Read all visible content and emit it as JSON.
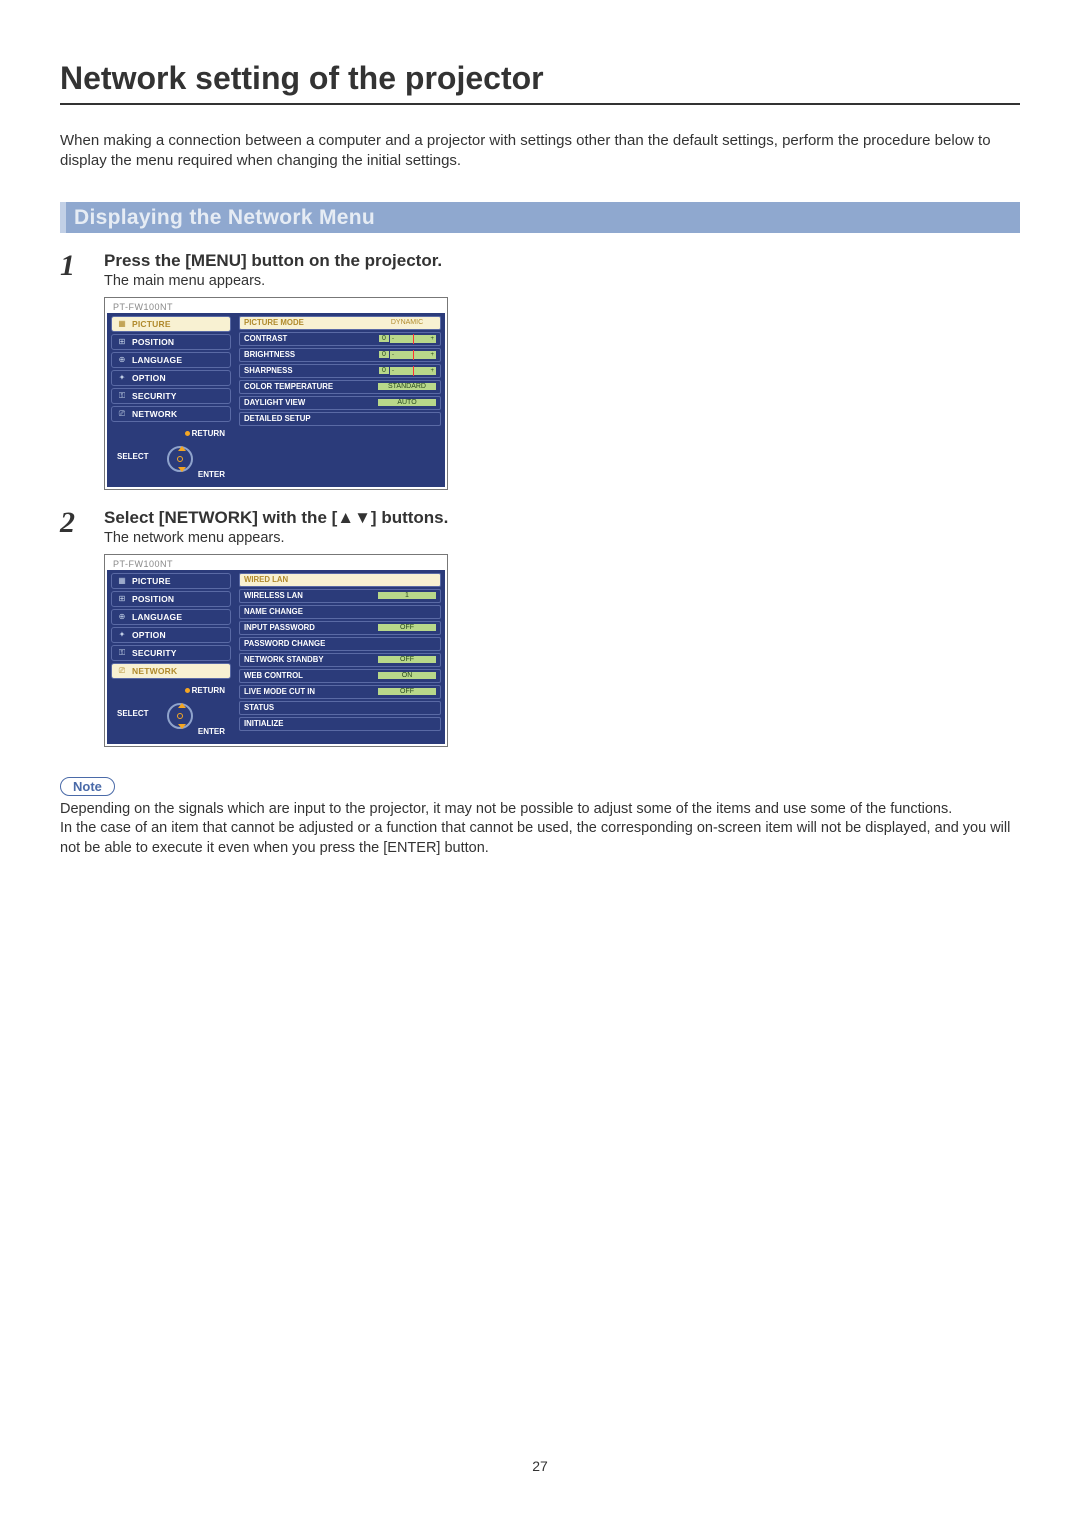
{
  "page": {
    "title": "Network setting of the projector",
    "intro": "When making a connection between a computer and a projector with settings other than the default settings, perform the procedure below to display the menu required when changing the initial settings.",
    "number": "27"
  },
  "section": {
    "heading": "Displaying the Network Menu"
  },
  "steps": {
    "s1": {
      "num": "1",
      "title": "Press the [MENU] button on the projector.",
      "text": "The main menu appears."
    },
    "s2": {
      "num": "2",
      "title": "Select [NETWORK] with the [▲▼] buttons.",
      "text": "The network menu appears."
    }
  },
  "osd_model": "PT-FW100NT",
  "menu": {
    "picture": "PICTURE",
    "position": "POSITION",
    "language": "LANGUAGE",
    "option": "OPTION",
    "security": "SECURITY",
    "network": "NETWORK"
  },
  "ctrl": {
    "return": "RETURN",
    "select": "SELECT",
    "enter": "ENTER"
  },
  "panel1": {
    "picture_mode": {
      "label": "PICTURE MODE",
      "value": "DYNAMIC"
    },
    "contrast": {
      "label": "CONTRAST",
      "value": "0"
    },
    "brightness": {
      "label": "BRIGHTNESS",
      "value": "0"
    },
    "sharpness": {
      "label": "SHARPNESS",
      "value": "0"
    },
    "color_temp": {
      "label": "COLOR TEMPERATURE",
      "value": "STANDARD"
    },
    "daylight": {
      "label": "DAYLIGHT VIEW",
      "value": "AUTO"
    },
    "detailed": {
      "label": "DETAILED SETUP"
    }
  },
  "panel2": {
    "wired": {
      "label": "WIRED LAN"
    },
    "wireless": {
      "label": "WIRELESS LAN",
      "value": "1"
    },
    "name": {
      "label": "NAME CHANGE"
    },
    "inputpw": {
      "label": "INPUT PASSWORD",
      "value": "OFF"
    },
    "pwchange": {
      "label": "PASSWORD CHANGE"
    },
    "standby": {
      "label": "NETWORK STANDBY",
      "value": "OFF"
    },
    "web": {
      "label": "WEB CONTROL",
      "value": "ON"
    },
    "livecut": {
      "label": "LIVE MODE CUT IN",
      "value": "OFF"
    },
    "status": {
      "label": "STATUS"
    },
    "initialize": {
      "label": "INITIALIZE"
    }
  },
  "note": {
    "label": "Note",
    "text1": "Depending on the signals which are input to the projector, it may not be possible to adjust some of the items and use some of the functions.",
    "text2": "In the case of an item that cannot be adjusted or a function that cannot be used, the corresponding on-screen item will not be displayed, and you will not be able to execute it even when you press the [ENTER] button."
  }
}
